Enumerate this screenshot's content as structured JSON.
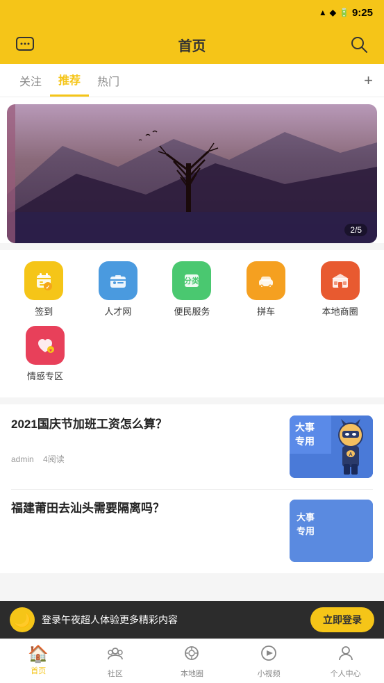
{
  "statusBar": {
    "time": "9:25",
    "batteryIcon": "🔋",
    "wifiIcon": "▲"
  },
  "header": {
    "title": "首页",
    "messageIcon": "💬",
    "searchIcon": "🔍"
  },
  "tabs": [
    {
      "label": "关注",
      "active": false
    },
    {
      "label": "推荐",
      "active": true
    },
    {
      "label": "热门",
      "active": false
    }
  ],
  "tabAdd": "+",
  "banner": {
    "counter": "2/5"
  },
  "iconGrid": {
    "row1": [
      {
        "label": "签到",
        "emoji": "🎒",
        "colorClass": "icon-yellow"
      },
      {
        "label": "人才网",
        "emoji": "🧰",
        "colorClass": "icon-blue"
      },
      {
        "label": "便民服务",
        "emoji": "📋",
        "colorClass": "icon-green"
      },
      {
        "label": "拼车",
        "emoji": "🚕",
        "colorClass": "icon-orange"
      },
      {
        "label": "本地商圈",
        "emoji": "🏪",
        "colorClass": "icon-red"
      }
    ],
    "row2": [
      {
        "label": "情感专区",
        "emoji": "❤️",
        "colorClass": "icon-pink"
      }
    ]
  },
  "cards": [
    {
      "title": "2021国庆节加班工资怎么算？",
      "author": "admin",
      "reads": "4阅读",
      "imageTopText": "大事专用",
      "imageBottomEmoji": "🦸"
    },
    {
      "title": "福建莆田去汕头需要隔离吗？",
      "author": "",
      "reads": ""
    }
  ],
  "notificationBar": {
    "avatarEmoji": "🌙",
    "text": "登录午夜超人体验更多精彩内容",
    "buttonLabel": "立即登录"
  },
  "bottomNav": [
    {
      "label": "首页",
      "emoji": "🏠",
      "active": true
    },
    {
      "label": "社区",
      "emoji": "👥",
      "active": false
    },
    {
      "label": "本地圈",
      "emoji": "⊙",
      "active": false
    },
    {
      "label": "小视频",
      "emoji": "▶",
      "active": false
    },
    {
      "label": "个人中心",
      "emoji": "👤",
      "active": false
    }
  ]
}
